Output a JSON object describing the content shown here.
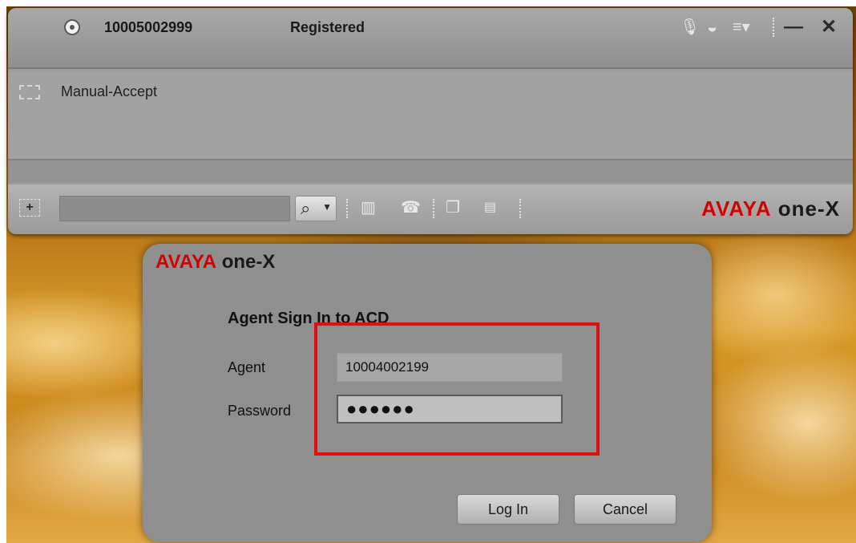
{
  "main_window": {
    "extension_number": "10005002999",
    "registration_status": "Registered",
    "title_icons": [
      "mute-microphone-icon",
      "headset-icon",
      "menu-list-icon"
    ],
    "minimize_label": "—",
    "close_label": "✕",
    "list": {
      "items": [
        {
          "label": "Manual-Accept",
          "checked": false
        }
      ]
    },
    "toolbar": {
      "add_label": "+",
      "search_value": "",
      "search_icon": "magnifier-icon",
      "tool_icons": [
        "contacts-book-icon",
        "dialpad-icon",
        "windows-icon",
        "status-icon"
      ]
    },
    "brand": {
      "avaya": "AVAYA",
      "onex": "one-X"
    }
  },
  "dialog": {
    "brand": {
      "avaya": "AVAYA",
      "onex": "one-X"
    },
    "title": "Agent Sign In to ACD",
    "agent_label": "Agent",
    "agent_value": "10004002199",
    "password_label": "Password",
    "password_masked": "●●●●●●",
    "login_button": "Log In",
    "cancel_button": "Cancel",
    "highlight_color": "#e01010"
  }
}
